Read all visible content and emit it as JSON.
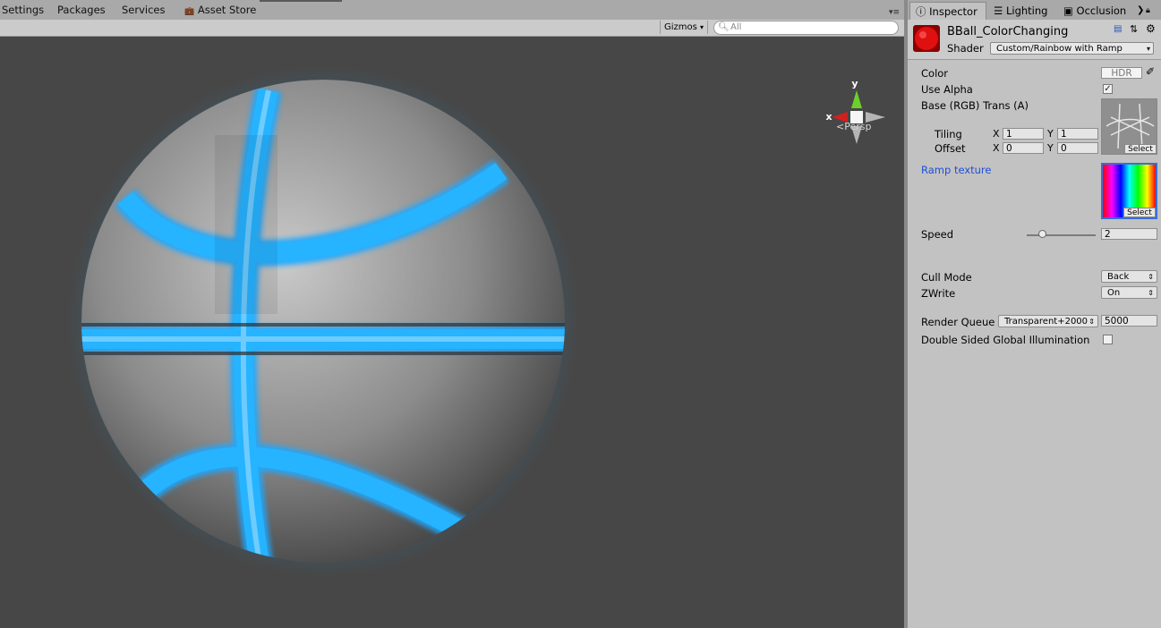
{
  "menu": {
    "items": [
      "Settings",
      "Packages",
      "Services",
      "Asset Store"
    ]
  },
  "scene_toolbar": {
    "gizmos_label": "Gizmos",
    "search_placeholder": "All"
  },
  "scene": {
    "persp_label": "Persp",
    "axis_x": "x",
    "axis_y": "y"
  },
  "inspector_tabs": {
    "inspector": "Inspector",
    "lighting": "Lighting",
    "occlusion": "Occlusion"
  },
  "material": {
    "name": "BBall_ColorChanging",
    "shader_label": "Shader",
    "shader_value": "Custom/Rainbow with Ramp"
  },
  "properties": {
    "color_label": "Color",
    "color_hdr": "HDR",
    "use_alpha_label": "Use Alpha",
    "use_alpha_checked": true,
    "base_label": "Base (RGB) Trans (A)",
    "tiling_label": "Tiling",
    "offset_label": "Offset",
    "x_label": "X",
    "y_label": "Y",
    "tiling_x": "1",
    "tiling_y": "1",
    "offset_x": "0",
    "offset_y": "0",
    "select_label": "Select",
    "ramp_label": "Ramp texture",
    "speed_label": "Speed",
    "speed_value": "2",
    "speed_fraction": 0.22,
    "cull_label": "Cull Mode",
    "cull_value": "Back",
    "zwrite_label": "ZWrite",
    "zwrite_value": "On",
    "render_queue_label": "Render Queue",
    "render_queue_dropdown": "Transparent+2000",
    "render_queue_value": "5000",
    "dsgi_label": "Double Sided Global Illumination",
    "dsgi_checked": false
  },
  "colors": {
    "glow": "#1ea8ff",
    "ramp_link": "#1f4fd8"
  }
}
